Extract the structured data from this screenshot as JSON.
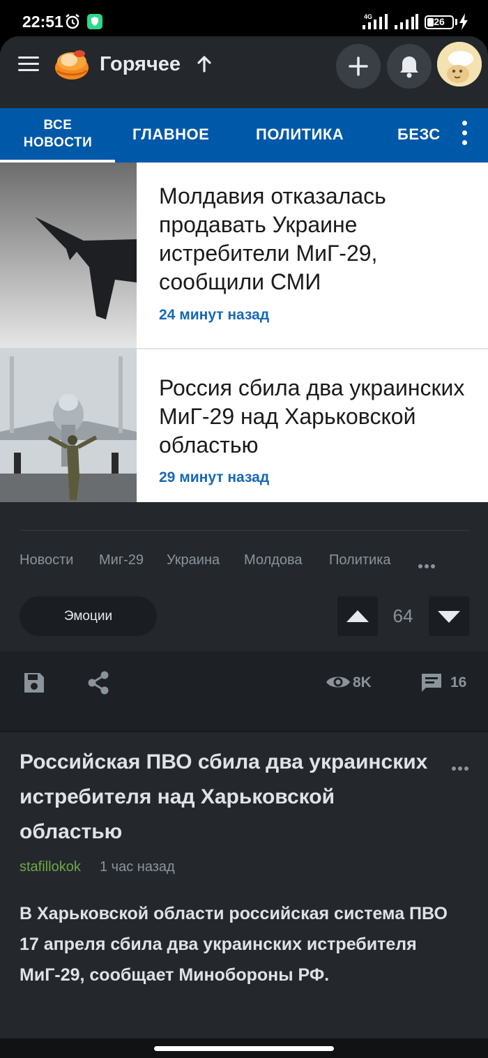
{
  "status_bar": {
    "time": "22:51",
    "network": "4G",
    "battery": "26",
    "battery_level": 0.26
  },
  "app_bar": {
    "title": "Горячее",
    "icons": [
      "menu-icon",
      "logo",
      "arrow-up-icon",
      "plus-icon",
      "bell-icon",
      "avatar"
    ]
  },
  "news_widget": {
    "tabs": [
      {
        "label_line1": "ВСЕ",
        "label_line2": "НОВОСТИ",
        "active": true
      },
      {
        "label": "ГЛАВНОЕ"
      },
      {
        "label": "ПОЛИТИКА"
      },
      {
        "label": "БЕЗС"
      }
    ],
    "stories": [
      {
        "title": "Молдавия отказалась продавать Украине истребители МиГ-29, сообщили СМИ",
        "time": "24 минут назад"
      },
      {
        "title": "Россия сбила два украинских МиГ-29 над Харьковской областью",
        "time": "29 минут назад"
      }
    ],
    "accent": "#0058a8",
    "time_color": "#1668b8"
  },
  "tags": [
    "Новости",
    "Миг-29",
    "Украина",
    "Молдова",
    "Политика"
  ],
  "reactions": {
    "emotions_label": "Эмоции",
    "rating": "64"
  },
  "actions": {
    "views": "8K",
    "comments": "16"
  },
  "post": {
    "title": "Российская ПВО сбила два украинских истребителя над Харьковской областью",
    "author": "stafillokok",
    "time": "1 час назад",
    "body": "В Харьковской области российская система ПВО 17 апреля сбила два украинских истребителя МиГ-29, сообщает Минобороны РФ.",
    "author_color": "#6fa844"
  }
}
